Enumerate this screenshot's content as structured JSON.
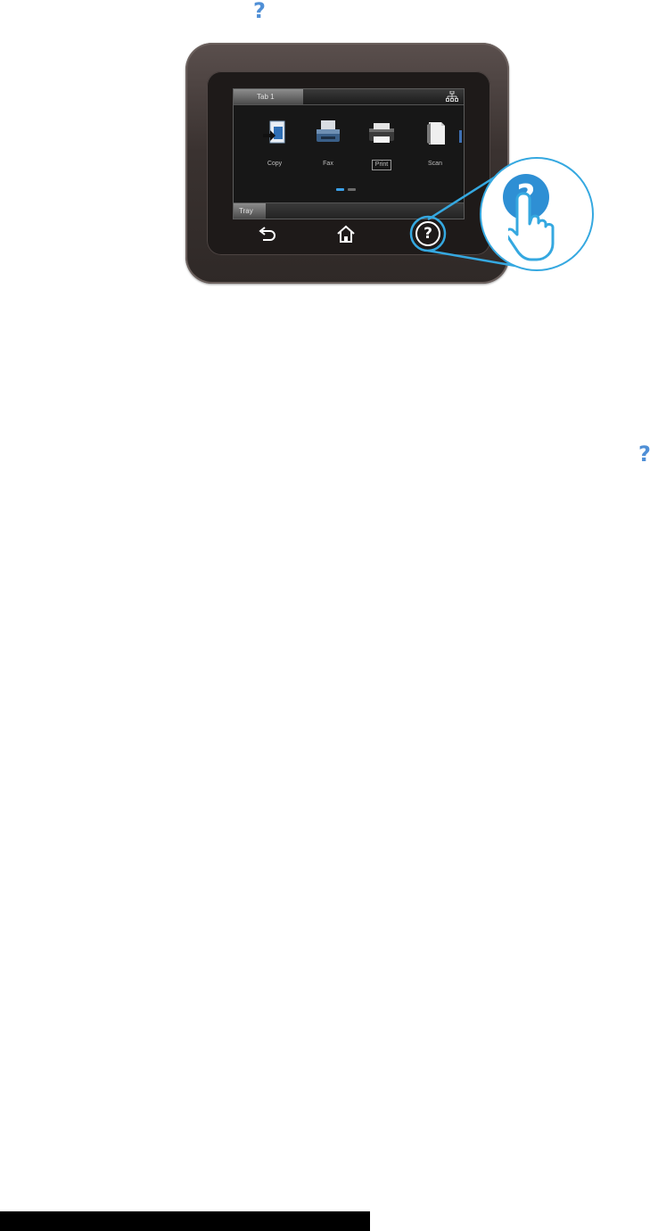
{
  "help_symbol": "?",
  "colors": {
    "help_blue": "#4f8fd6",
    "callout_cyan": "#35a8e0",
    "screen_dark": "#171717",
    "bezel_brown": "#3a3230"
  },
  "control_panel": {
    "screen": {
      "top_tab_label": "Tab 1",
      "network_icon": "network-icon",
      "apps": [
        {
          "icon": "scan-to-folder-icon",
          "label": "Copy"
        },
        {
          "icon": "fax-icon",
          "label": "Fax"
        },
        {
          "icon": "printer-icon",
          "label": "Print",
          "selected": true
        },
        {
          "icon": "document-icon",
          "label": "Scan"
        }
      ],
      "page_indicator": {
        "current": 1,
        "total": 2
      },
      "bottom_tab_label": "Tray"
    },
    "nav_buttons": [
      {
        "icon": "back-arrow-icon"
      },
      {
        "icon": "home-icon"
      },
      {
        "icon": "help-icon",
        "symbol": "?"
      }
    ]
  },
  "callout": {
    "icon": "help-icon",
    "symbol": "?",
    "gesture": "touch-hand-icon"
  }
}
